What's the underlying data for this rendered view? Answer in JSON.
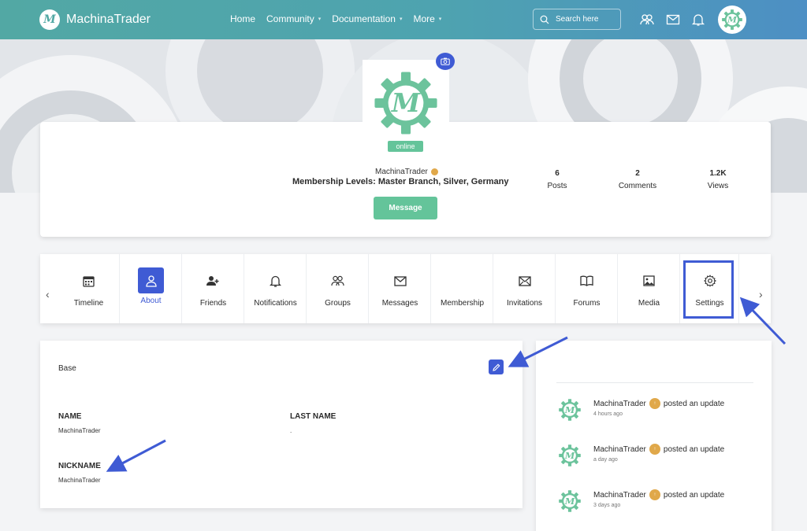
{
  "brand": {
    "name": "MachinaTrader"
  },
  "nav": {
    "items": [
      {
        "label": "Home",
        "has_menu": false
      },
      {
        "label": "Community",
        "has_menu": true
      },
      {
        "label": "Documentation",
        "has_menu": true
      },
      {
        "label": "More",
        "has_menu": true
      }
    ]
  },
  "search": {
    "placeholder": "Search here"
  },
  "profile": {
    "status": "online",
    "name": "MachinaTrader",
    "membership": "Membership Levels: Master Branch, Silver, Germany",
    "message_button": "Message",
    "stats": [
      {
        "value": "6",
        "label": "Posts"
      },
      {
        "value": "2",
        "label": "Comments"
      },
      {
        "value": "1.2K",
        "label": "Views"
      }
    ]
  },
  "tabs": [
    {
      "label": "Timeline",
      "icon": "calendar-icon"
    },
    {
      "label": "About",
      "icon": "user-icon",
      "active": true
    },
    {
      "label": "Friends",
      "icon": "add-friend-icon"
    },
    {
      "label": "Notifications",
      "icon": "bell-icon"
    },
    {
      "label": "Groups",
      "icon": "groups-icon"
    },
    {
      "label": "Messages",
      "icon": "envelope-icon"
    },
    {
      "label": "Membership",
      "icon": "membership-icon"
    },
    {
      "label": "Invitations",
      "icon": "invitation-icon"
    },
    {
      "label": "Forums",
      "icon": "book-icon"
    },
    {
      "label": "Media",
      "icon": "image-icon"
    },
    {
      "label": "Settings",
      "icon": "gear-icon"
    }
  ],
  "base": {
    "title": "Base",
    "fields": {
      "name": {
        "label": "NAME",
        "value": "MachinaTrader"
      },
      "last_name": {
        "label": "LAST NAME",
        "value": "."
      },
      "nickname": {
        "label": "NICKNAME",
        "value": "MachinaTrader"
      }
    }
  },
  "activity": [
    {
      "user": "MachinaTrader",
      "action": "posted an update",
      "time": "4 hours ago"
    },
    {
      "user": "MachinaTrader",
      "action": "posted an update",
      "time": "a day ago"
    },
    {
      "user": "MachinaTrader",
      "action": "posted an update",
      "time": "3 days ago"
    }
  ],
  "colors": {
    "accent": "#3f5bd4",
    "brand_green": "#64c49a",
    "header_start": "#52a8a4",
    "header_end": "#4d8fc4"
  }
}
